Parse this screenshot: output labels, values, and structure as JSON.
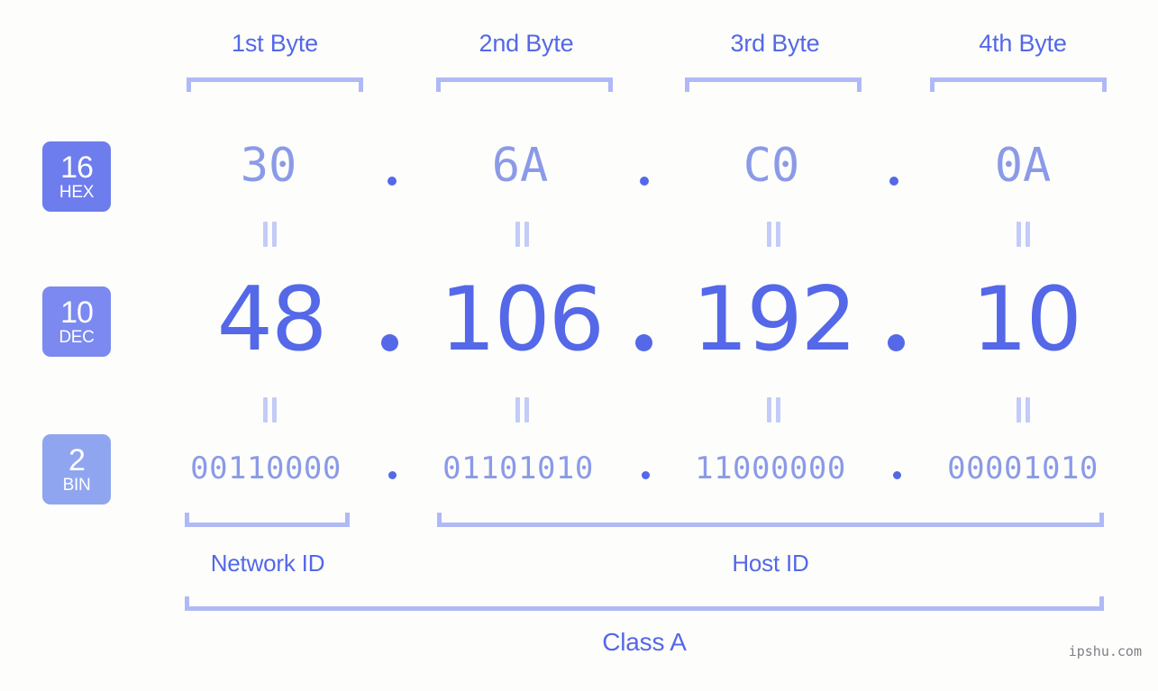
{
  "background_color": "#fdfefb",
  "accent_color": "#5468e8",
  "accent_light_color": "#8b9ae8",
  "bracket_color": "#b0b9f7",
  "equals_color": "#c3cbf8",
  "header": {
    "byte_labels": [
      {
        "label": "1st Byte"
      },
      {
        "label": "2nd Byte"
      },
      {
        "label": "3rd Byte"
      },
      {
        "label": "4th Byte"
      }
    ]
  },
  "bases": [
    {
      "id": "hex",
      "number": "16",
      "name": "HEX",
      "color": "#6d7ded"
    },
    {
      "id": "dec",
      "number": "10",
      "name": "DEC",
      "color": "#7b89f0"
    },
    {
      "id": "bin",
      "number": "2",
      "name": "BIN",
      "color": "#8fa5f0"
    }
  ],
  "rows": {
    "hex": {
      "values": [
        "30",
        "6A",
        "C0",
        "0A"
      ],
      "separator": "."
    },
    "dec": {
      "values": [
        "48",
        "106",
        "192",
        "10"
      ],
      "separator": "."
    },
    "bin": {
      "values": [
        "00110000",
        "01101010",
        "11000000",
        "00001010"
      ],
      "separator": "."
    }
  },
  "equality_markers": {
    "symbol": "=",
    "count_per_row": 4
  },
  "segments": {
    "network_id": {
      "label": "Network ID"
    },
    "host_id": {
      "label": "Host ID"
    }
  },
  "class": {
    "label": "Class A"
  },
  "watermark": {
    "text": "ipshu.com"
  },
  "ip": {
    "dotted_decimal": "48.106.192.10",
    "hex": "30.6A.C0.0A",
    "binary": "00110000.01101010.11000000.00001010"
  }
}
